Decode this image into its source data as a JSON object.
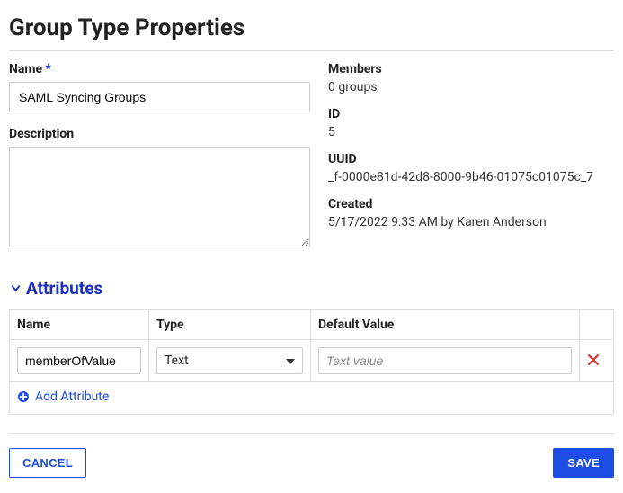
{
  "title": "Group Type Properties",
  "form": {
    "name_label": "Name",
    "name_required_mark": "*",
    "name_value": "SAML Syncing Groups",
    "description_label": "Description",
    "description_value": ""
  },
  "meta": {
    "members_label": "Members",
    "members_value": "0 groups",
    "id_label": "ID",
    "id_value": "5",
    "uuid_label": "UUID",
    "uuid_value": "_f-0000e81d-42d8-8000-9b46-01075c01075c_7",
    "created_label": "Created",
    "created_value": "5/17/2022 9:33 AM by Karen Anderson"
  },
  "attributes": {
    "section_title": "Attributes",
    "columns": {
      "name": "Name",
      "type": "Type",
      "default_value": "Default Value"
    },
    "rows": [
      {
        "name": "memberOfValue",
        "type": "Text",
        "default_value": "",
        "default_placeholder": "Text value"
      }
    ],
    "add_label": "Add Attribute"
  },
  "footer": {
    "cancel": "CANCEL",
    "save": "SAVE"
  }
}
